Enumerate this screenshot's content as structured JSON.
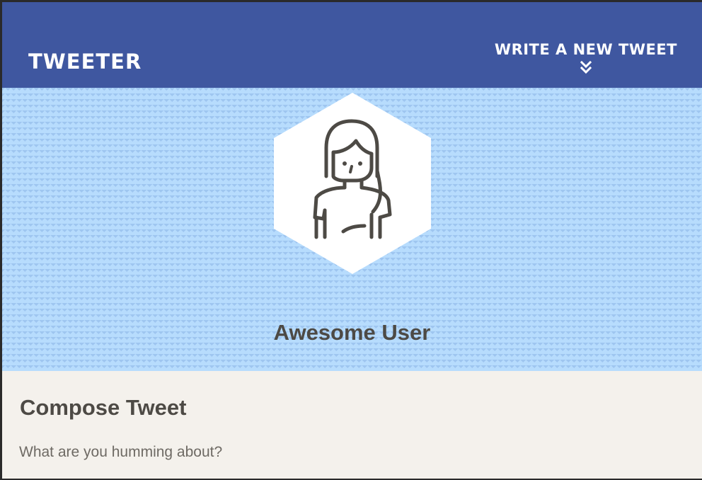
{
  "colors": {
    "nav_bg": "#3f57a0",
    "nav_text": "#ffffff",
    "profile_bg": "#b7dcfd",
    "compose_bg": "#f4f1ec",
    "text_dark": "#4d4a45"
  },
  "navbar": {
    "brand": "TWEETER",
    "compose_toggle_label": "WRITE A NEW TWEET",
    "compose_toggle_icon": "double-chevron-down-icon"
  },
  "profile": {
    "avatar_icon": "female-user-avatar-icon",
    "name": "Awesome User"
  },
  "compose": {
    "title": "Compose Tweet",
    "placeholder": "What are you humming about?",
    "value": ""
  }
}
